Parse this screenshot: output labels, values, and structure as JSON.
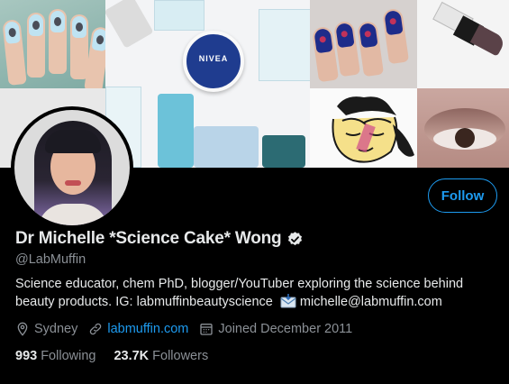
{
  "profile": {
    "display_name": "Dr Michelle *Science Cake* Wong",
    "handle": "@LabMuffin",
    "bio_text": "Science educator, chem PhD, blogger/YouTuber exploring the science behind beauty products. IG: labmuffinbeautyscience",
    "bio_email": "michelle@labmuffin.com",
    "location": "Sydney",
    "website": "labmuffin.com",
    "joined": "Joined December 2011",
    "following_count": "993",
    "following_label": "Following",
    "followers_count": "23.7K",
    "followers_label": "Followers"
  },
  "actions": {
    "follow_label": "Follow"
  },
  "banner": {
    "product_label": "NIVEA"
  },
  "colors": {
    "accent": "#1d9bf0",
    "background": "#000000",
    "muted_text": "#8b9096",
    "primary_text": "#e7e9ea"
  },
  "icons": [
    "verified-badge-icon",
    "envelope-icon",
    "location-pin-icon",
    "link-icon",
    "calendar-icon"
  ]
}
